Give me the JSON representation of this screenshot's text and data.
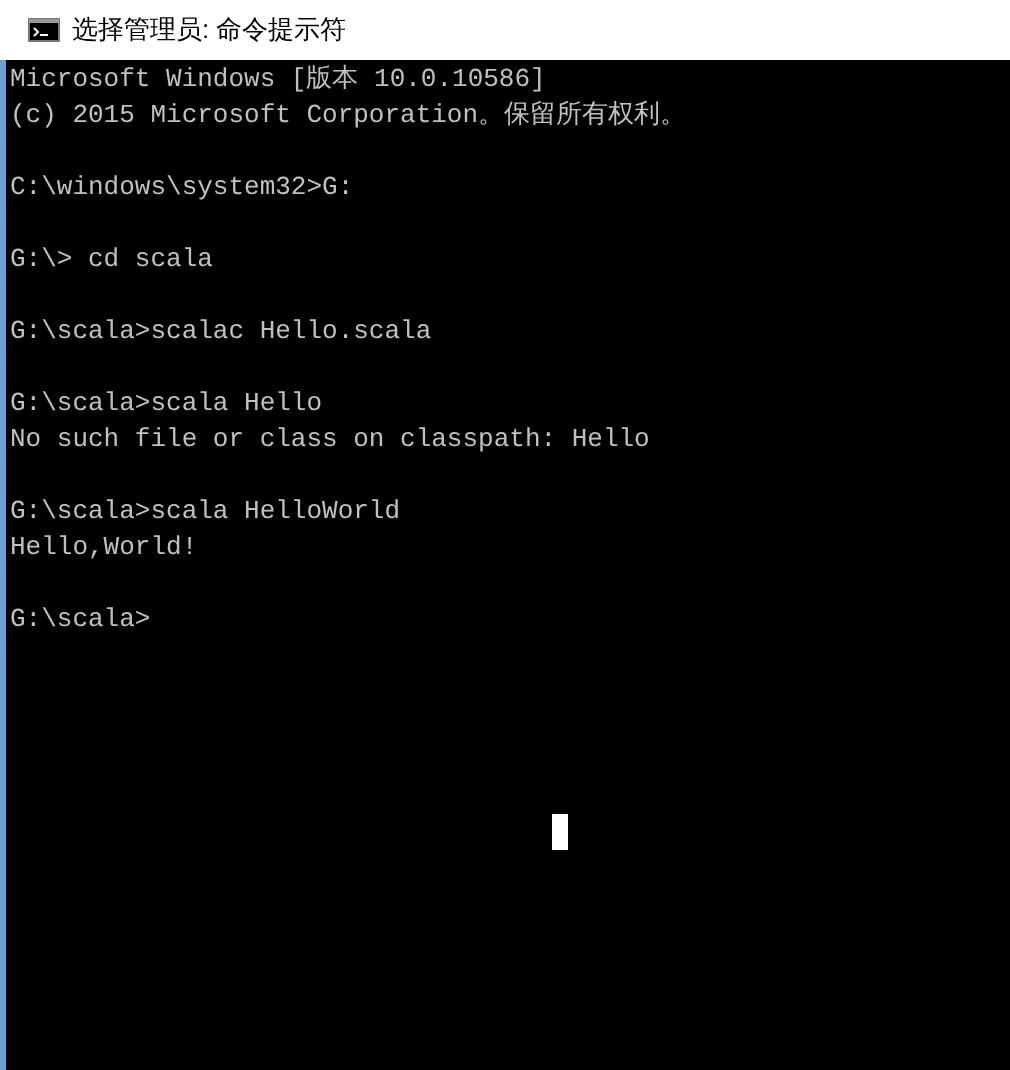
{
  "window": {
    "title": "选择管理员: 命令提示符"
  },
  "console": {
    "blocks": [
      [
        "Microsoft Windows [版本 10.0.10586]",
        "(c) 2015 Microsoft Corporation。保留所有权利。"
      ],
      [
        "C:\\windows\\system32>G:"
      ],
      [
        "G:\\> cd scala"
      ],
      [
        "G:\\scala>scalac Hello.scala"
      ],
      [
        "G:\\scala>scala Hello",
        "No such file or class on classpath: Hello"
      ],
      [
        "G:\\scala>scala HelloWorld",
        "Hello,World!"
      ],
      [
        "G:\\scala>"
      ]
    ]
  }
}
